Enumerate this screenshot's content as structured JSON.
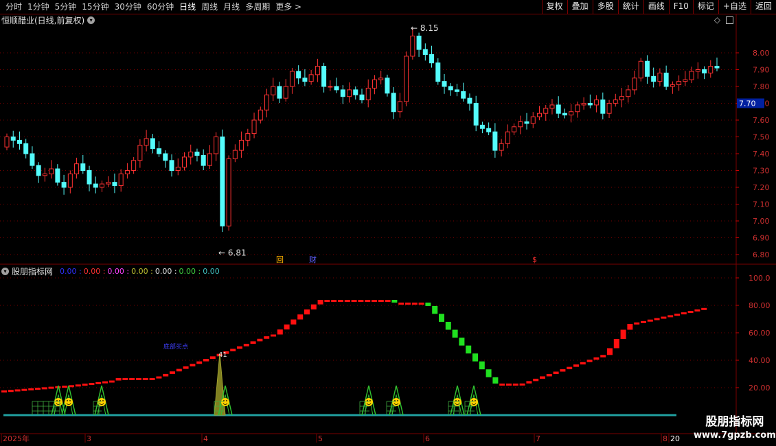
{
  "toolbar": {
    "periods": [
      "分时",
      "1分钟",
      "5分钟",
      "15分钟",
      "30分钟",
      "60分钟",
      "日线",
      "周线",
      "月线",
      "多周期",
      "更多 >"
    ],
    "active_period": "日线",
    "tools": [
      "复权",
      "叠加",
      "多股",
      "统计",
      "画线",
      "F10",
      "标记",
      "+自选",
      "返回"
    ]
  },
  "stock": {
    "title": "恒顺醋业(日线,前复权)",
    "current_price_tag": "7.70",
    "high_label": "8.15",
    "low_label": "6.81",
    "markers": [
      "回",
      "财",
      "$"
    ]
  },
  "indicator": {
    "name": "股朋指标网",
    "values": [
      {
        "text": "0.00",
        "color": "#3030ff"
      },
      {
        "text": "0.00",
        "color": "#ff3030"
      },
      {
        "text": "0.00",
        "color": "#ff40ff"
      },
      {
        "text": "0.00",
        "color": "#c0c030"
      },
      {
        "text": "0.00",
        "color": "#e0e0e0"
      },
      {
        "text": "0.00",
        "color": "#40d040"
      },
      {
        "text": "0.00",
        "color": "#40c0c0"
      }
    ],
    "peak_label": "41",
    "blue_text": "底部买点"
  },
  "price_axis": [
    "8.00",
    "7.90",
    "7.80",
    "7.70",
    "7.60",
    "7.50",
    "7.40",
    "7.30",
    "7.20",
    "7.10",
    "7.00",
    "6.90",
    "6.80"
  ],
  "indicator_axis": [
    "100.0",
    "80.00",
    "60.00",
    "40.00",
    "20.00"
  ],
  "date_axis": [
    "2025年",
    "3",
    "4",
    "5",
    "6",
    "7",
    "8",
    "20"
  ],
  "watermark": {
    "line1": "股朋指标网",
    "line2": "www.7gpzb.com"
  },
  "colors": {
    "up": "#ff3232",
    "down": "#54fcfc",
    "grid": "#7a0000",
    "indicator_green": "#20e020",
    "indicator_red": "#ff1010"
  }
}
